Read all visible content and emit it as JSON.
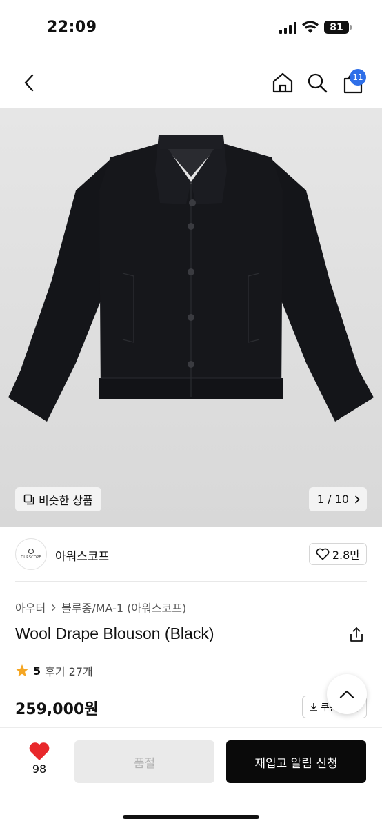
{
  "status_bar": {
    "time": "22:09",
    "battery": "81"
  },
  "nav": {
    "cart_count": "11"
  },
  "gallery": {
    "similar_label": "비슷한 상품",
    "page_counter": "1 / 10"
  },
  "brand": {
    "logo_text": "OURSCOPE",
    "name": "아워스코프",
    "likes": "2.8만"
  },
  "product": {
    "breadcrumb": [
      "아우터",
      "블루종/MA-1 (아워스코프)"
    ],
    "title": "Wool Drape Blouson (Black)",
    "rating": "5",
    "reviews": "후기 27개",
    "price": "259,000원",
    "coupon_label": "쿠폰 받기"
  },
  "bottom_bar": {
    "wish_count": "98",
    "soldout_label": "품절",
    "restock_label": "재입고 알림 신청"
  },
  "colors": {
    "accent_blue": "#2f6fe8",
    "heart_red": "#e8282b",
    "star_orange": "#f5a623",
    "primary_black": "#0a0a0a"
  }
}
